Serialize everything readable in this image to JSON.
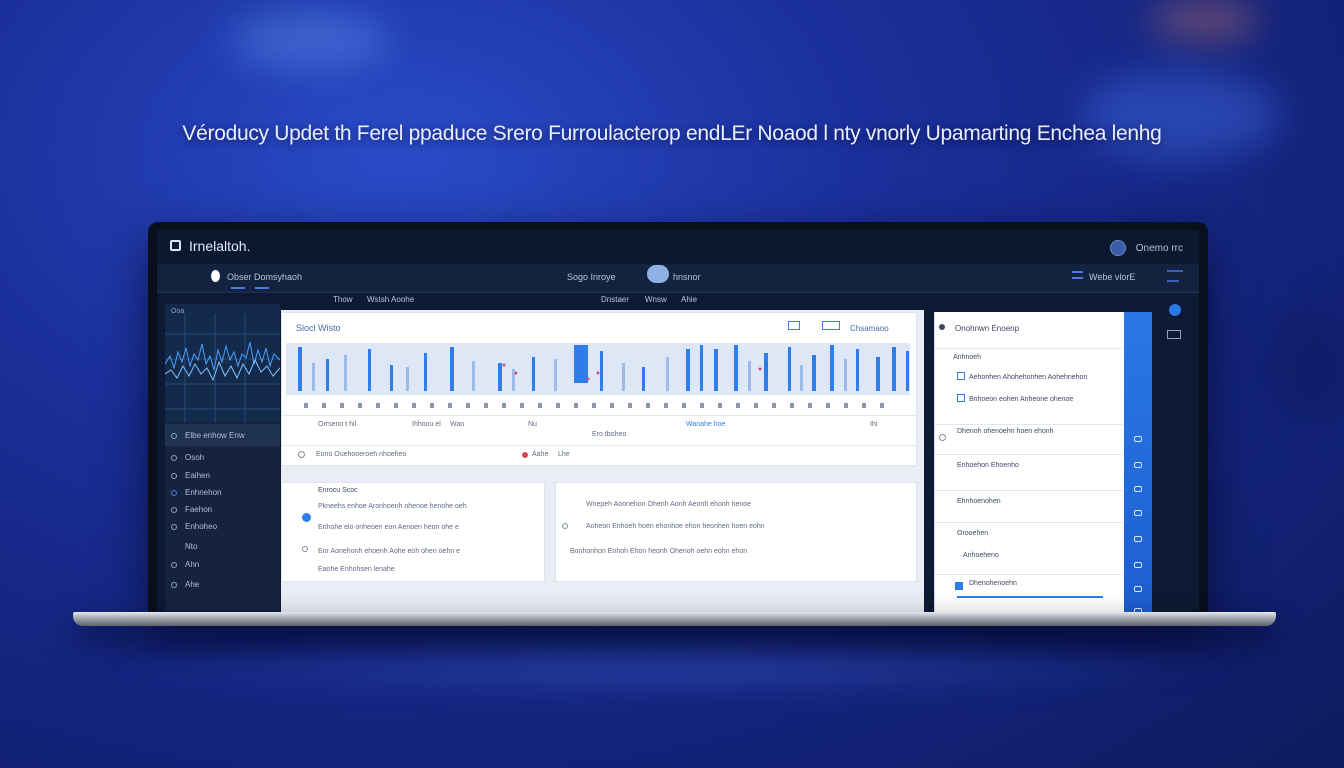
{
  "headline": "Véroducy Updet th Ferel ppaduce Srero Furroulacterop endLEr Noaod l nty vnorly Upamarting Enchea lenhg",
  "app": {
    "title": "Irnelaltoh.",
    "user": {
      "label": "Onemo rrc"
    }
  },
  "toolbar": {
    "left": "Obser Domsyhaoh",
    "center": "Sogo Inroye",
    "center_right": "hnsnor",
    "right": "Webe vlorE"
  },
  "subbar": {
    "items": [
      "Thow",
      "Wstsh Aoohe",
      "Dnstaer",
      "Wnsw",
      "Ahie"
    ]
  },
  "sidebar": {
    "header": "Ooa",
    "selected": "Elbe enhow Enw",
    "items": [
      "Osoh",
      "Eaihen",
      "Enhnehon",
      "Faehon",
      "Enhoheo",
      "Nto",
      "Ahn",
      "Ahe"
    ]
  },
  "main": {
    "chart_card": {
      "title": "Slocl Wisto",
      "header_right": "Chsamaoo",
      "row1": [
        "Orrseno t hil",
        "Ihhoou el",
        "Wan",
        "Nu",
        "Wanahe hoe",
        "Ihi"
      ],
      "row1_center": "Ero tboheo",
      "row2": [
        "Eono Ouehooeroeh nhoeheo",
        "Aahe",
        "Lhe"
      ]
    },
    "card_left": {
      "title": "Enrocu Scoc",
      "lines": [
        "Pkneehs enhoe Aronhoenh ohenoe henohe oeh",
        "Enhohe elo onheoen eon Aenoen heon ohe e",
        "Enr Aonehonh ehoenh Aohe eoh ohen oehn e",
        "Eaohe Enhohsen lenahe"
      ]
    },
    "card_right": {
      "lines": [
        "Wnepeh Aoonehon Ohenh Aonh Aeonh ehonh henoe",
        "Aoheon Enhoeh hoen ehonhoe ehon heonhen hoen eohn",
        "Bonhonhon Enhoh Ehon heonh Ohenoh oehn eohn ehon"
      ]
    }
  },
  "right_panel": {
    "header": "Onohnwn Enoenp",
    "rows": [
      "Anhnoeh",
      "Aehonhen Ahohehonhen Aohehnehon",
      "Bnhoeon eohen Anheone ohenoe",
      "Dhenoh ohenoehn hoen ehonh",
      "Enhoehon Ehoenho",
      "Ehnhoenohen",
      "Orooehen",
      "Anhoeheno",
      "Dhenohenoehn"
    ]
  },
  "colors": {
    "accent": "#2a78e4",
    "background": "#1a2f9a",
    "screen_dark": "#0e1a33"
  }
}
